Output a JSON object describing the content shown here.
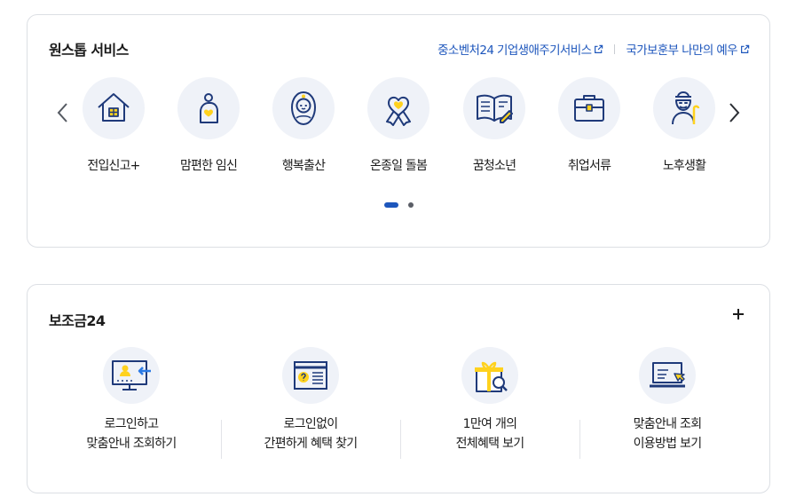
{
  "onestop": {
    "title": "원스톱 서비스",
    "links": [
      {
        "label": "중소벤처24 기업생애주기서비스",
        "icon": "external-link-icon"
      },
      {
        "label": "국가보훈부 나만의 예우",
        "icon": "external-link-icon"
      }
    ],
    "items": [
      {
        "label": "전입신고+",
        "icon": "house-icon"
      },
      {
        "label": "맘편한 임신",
        "icon": "pregnancy-icon"
      },
      {
        "label": "행복출산",
        "icon": "newborn-baby-icon"
      },
      {
        "label": "온종일 돌봄",
        "icon": "care-ribbon-icon"
      },
      {
        "label": "꿈청소년",
        "icon": "open-book-pencil-icon"
      },
      {
        "label": "취업서류",
        "icon": "briefcase-icon"
      },
      {
        "label": "노후생활",
        "icon": "elderly-cane-icon"
      }
    ],
    "pagination": {
      "current": 1,
      "total": 2
    }
  },
  "subsidy": {
    "title": "보조금24",
    "more_icon": "plus-icon",
    "items": [
      {
        "line1": "로그인하고",
        "line2": "맞춤안내 조회하기",
        "icon": "login-monitor-icon"
      },
      {
        "line1": "로그인없이",
        "line2": "간편하게 혜택 찾기",
        "icon": "question-document-icon"
      },
      {
        "line1": "1만여 개의",
        "line2": "전체혜택 보기",
        "icon": "gift-search-icon"
      },
      {
        "line1": "맞춤안내 조회",
        "line2": "이용방법 보기",
        "icon": "laptop-guide-icon"
      }
    ]
  },
  "colors": {
    "accent_blue": "#1d56bc",
    "icon_navy": "#1f3a7a",
    "icon_yellow": "#ffd21e",
    "icon_bg": "#eff2f8",
    "border": "#dcdfe4"
  }
}
